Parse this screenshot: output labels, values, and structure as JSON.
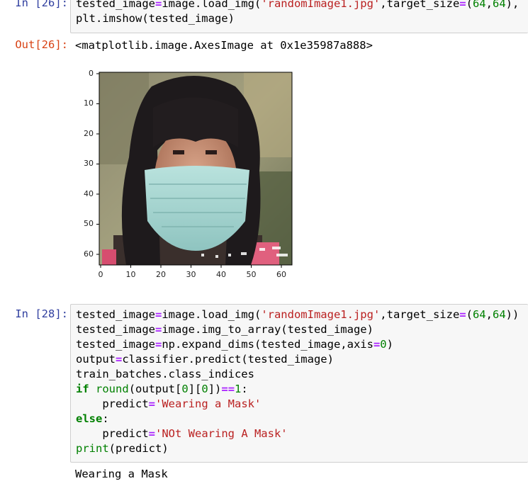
{
  "cell1": {
    "in_prompt": "In [26]:",
    "line1": [
      "tested_image",
      "=",
      "image.load_img(",
      "'randomImage1.jpg'",
      ",target_size",
      "=",
      "(",
      "64",
      ",",
      "64",
      "),"
    ],
    "line2": "plt.imshow(tested_image)",
    "out_prompt": "Out[26]:",
    "out_text": "<matplotlib.image.AxesImage at 0x1e35987a888>"
  },
  "image_axes": {
    "y_ticks": [
      "0",
      "10",
      "20",
      "30",
      "40",
      "50",
      "60"
    ],
    "x_ticks": [
      "0",
      "10",
      "20",
      "30",
      "40",
      "50",
      "60"
    ],
    "image_description_icon": "masked-face-image"
  },
  "cell2": {
    "in_prompt": "In [28]:",
    "l1": {
      "a": "tested_image",
      "b": "=",
      "c": "image.load_img(",
      "d": "'randomImage1.jpg'",
      "e": ",target_size",
      "f": "=",
      "g": "(",
      "h": "64",
      "i": ",",
      "j": "64",
      "k": "))"
    },
    "l2": {
      "a": "tested_image",
      "b": "=",
      "c": "image.img_to_array(tested_image)"
    },
    "l3": {
      "a": "tested_image",
      "b": "=",
      "c": "np.expand_dims(tested_image,axis",
      "d": "=",
      "e": "0",
      "f": ")"
    },
    "l4": {
      "a": "output",
      "b": "=",
      "c": "classifier.predict(tested_image)"
    },
    "l5": "train_batches.class_indices",
    "l6": {
      "a": "if",
      "b": " ",
      "c": "round",
      "d": "(output[",
      "e": "0",
      "f": "][",
      "g": "0",
      "h": "])",
      "i": "==",
      "j": "1",
      "k": ":"
    },
    "l7": {
      "a": "    predict",
      "b": "=",
      "c": "'Wearing a Mask'"
    },
    "l8": {
      "a": "else",
      "b": ":"
    },
    "l9": {
      "a": "    predict",
      "b": "=",
      "c": "'NOt Wearing A Mask'"
    },
    "l10": {
      "a": "print",
      "b": "(predict)"
    },
    "output": "Wearing a Mask"
  },
  "colors": {
    "in_prompt": "#303f9f",
    "out_prompt": "#d84315",
    "keyword": "#008000",
    "string": "#ba2121",
    "operator": "#aa22ff",
    "cell_bg": "#f7f7f7"
  }
}
